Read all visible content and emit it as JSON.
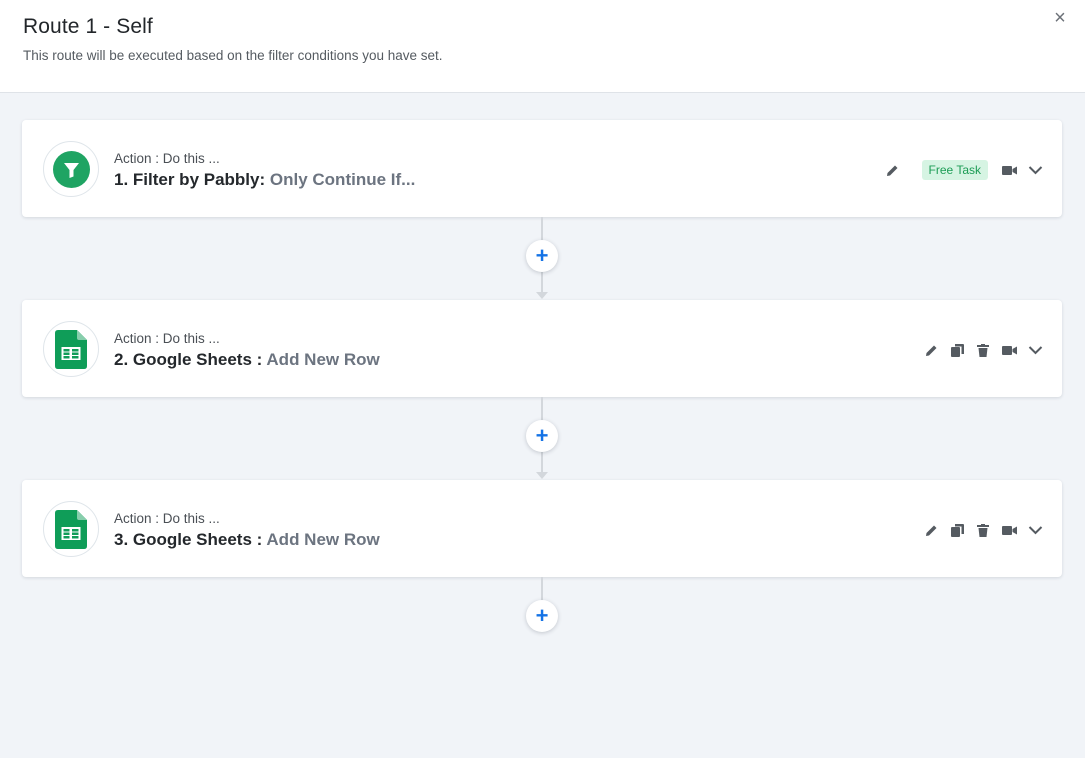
{
  "header": {
    "title": "Route 1 - Self",
    "subtitle": "This route will be executed based on the filter conditions you have set.",
    "close_label": "×"
  },
  "steps": [
    {
      "app": "filter-icon",
      "subtitle": "Action : Do this ...",
      "title": "1. Filter by Pabbly:",
      "event": "Only Continue If...",
      "badge": "Free Task",
      "icons": [
        "pencil-icon",
        "video-icon",
        "chevron-down-icon"
      ]
    },
    {
      "app": "google-sheets-icon",
      "subtitle": "Action : Do this ...",
      "title": "2. Google Sheets :",
      "event": "Add New Row",
      "icons": [
        "pencil-icon",
        "copy-icon",
        "trash-icon",
        "video-icon",
        "chevron-down-icon"
      ]
    },
    {
      "app": "google-sheets-icon",
      "subtitle": "Action : Do this ...",
      "title": "3. Google Sheets :",
      "event": "Add New Row",
      "icons": [
        "pencil-icon",
        "copy-icon",
        "trash-icon",
        "video-icon",
        "chevron-down-icon"
      ]
    }
  ],
  "add_step_label": "+",
  "colors": {
    "accent": "#1573e6",
    "filter_green": "#1fa463",
    "sheets_green": "#0f9d58",
    "badge_bg": "#d6f4e3",
    "badge_text": "#1c9c55",
    "background": "#f1f4f8"
  }
}
